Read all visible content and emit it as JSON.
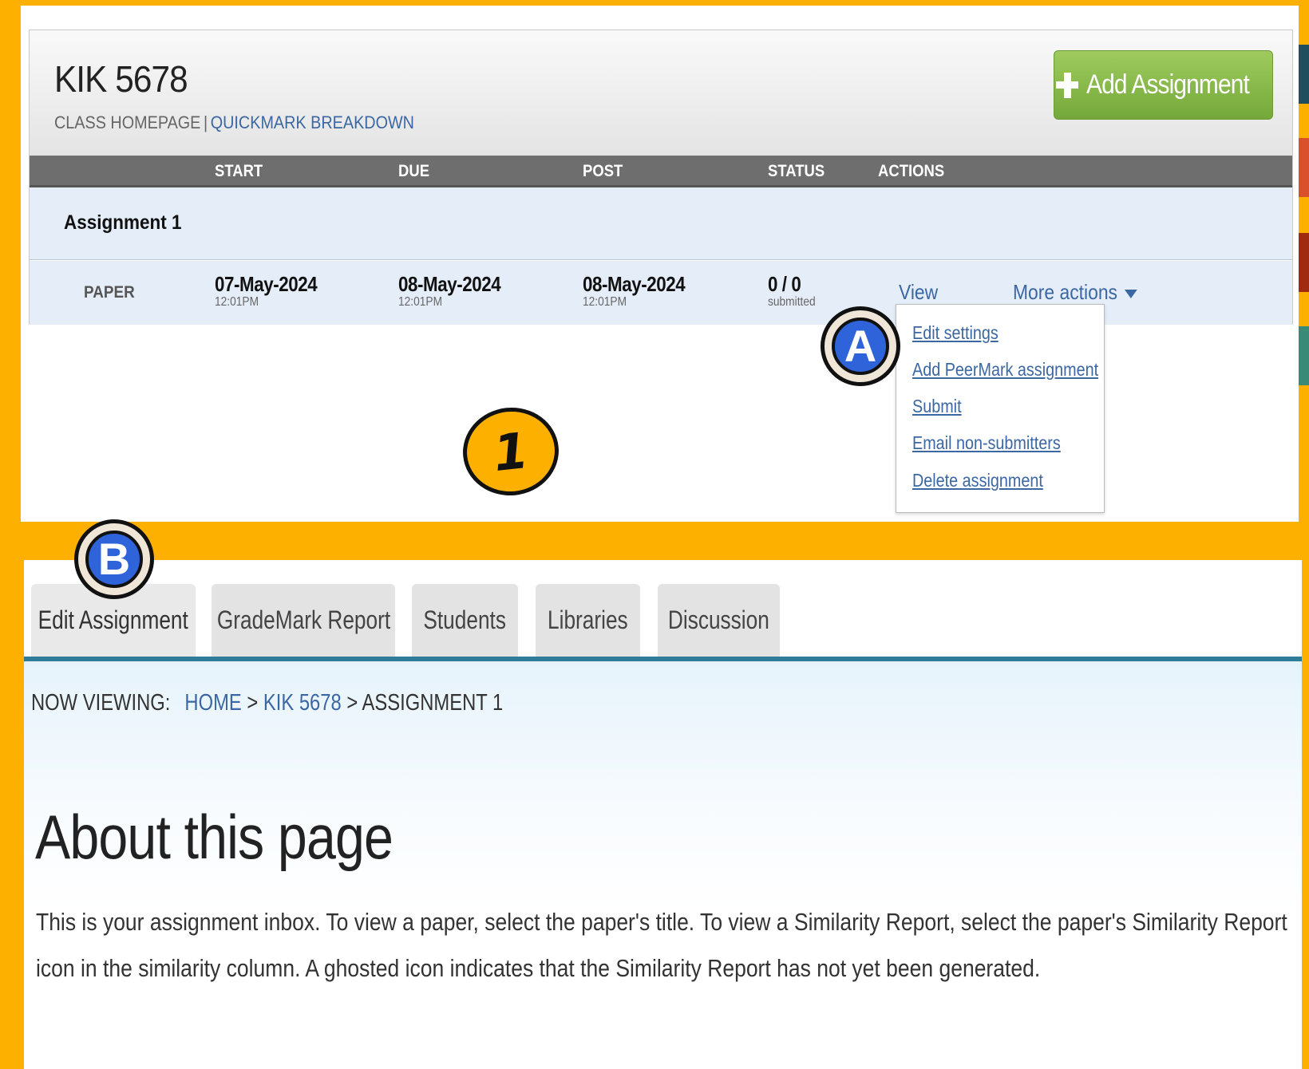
{
  "class": {
    "title": "KIK 5678",
    "subnav": {
      "home": "CLASS HOMEPAGE",
      "separator": "|",
      "quickmark": "QUICKMARK BREAKDOWN"
    },
    "add_button": "Add Assignment"
  },
  "table": {
    "headers": {
      "start": "START",
      "due": "DUE",
      "post": "POST",
      "status": "STATUS",
      "actions": "ACTIONS"
    },
    "assignment": {
      "name": "Assignment 1",
      "type": "PAPER",
      "start": {
        "date": "07-May-2024",
        "time": "12:01PM"
      },
      "due": {
        "date": "08-May-2024",
        "time": "12:01PM"
      },
      "post": {
        "date": "08-May-2024",
        "time": "12:01PM"
      },
      "status": {
        "count": "0 / 0",
        "label": "submitted"
      },
      "view": "View",
      "more_actions": "More actions"
    }
  },
  "dropdown": [
    "Edit settings",
    "Add PeerMark assignment",
    "Submit",
    "Email non-submitters",
    "Delete assignment"
  ],
  "badges": {
    "a": "A",
    "b": "B",
    "step": "1"
  },
  "tabs": [
    "Edit Assignment",
    "GradeMark Report",
    "Students",
    "Libraries",
    "Discussion"
  ],
  "breadcrumb": {
    "label": "NOW VIEWING:",
    "home": "HOME",
    "sep": ">",
    "class": "KIK 5678",
    "current": "ASSIGNMENT 1"
  },
  "about": {
    "heading": "About this page",
    "text": "This is your assignment inbox. To view a paper, select the paper's title. To view a Similarity Report, select the paper's Similarity Report icon in the similarity column. A ghosted icon indicates that the Similarity Report has not yet been generated."
  },
  "colors": {
    "frame": "#FDB000",
    "link": "#3b67a3",
    "add_button": "#8cbd4b",
    "tab_underline": "#2f7c98",
    "badge_blue": "#2f63d9",
    "stripes": [
      "#1f4e5e",
      "#d9502a",
      "#a02a10",
      "#3a8a78"
    ]
  }
}
